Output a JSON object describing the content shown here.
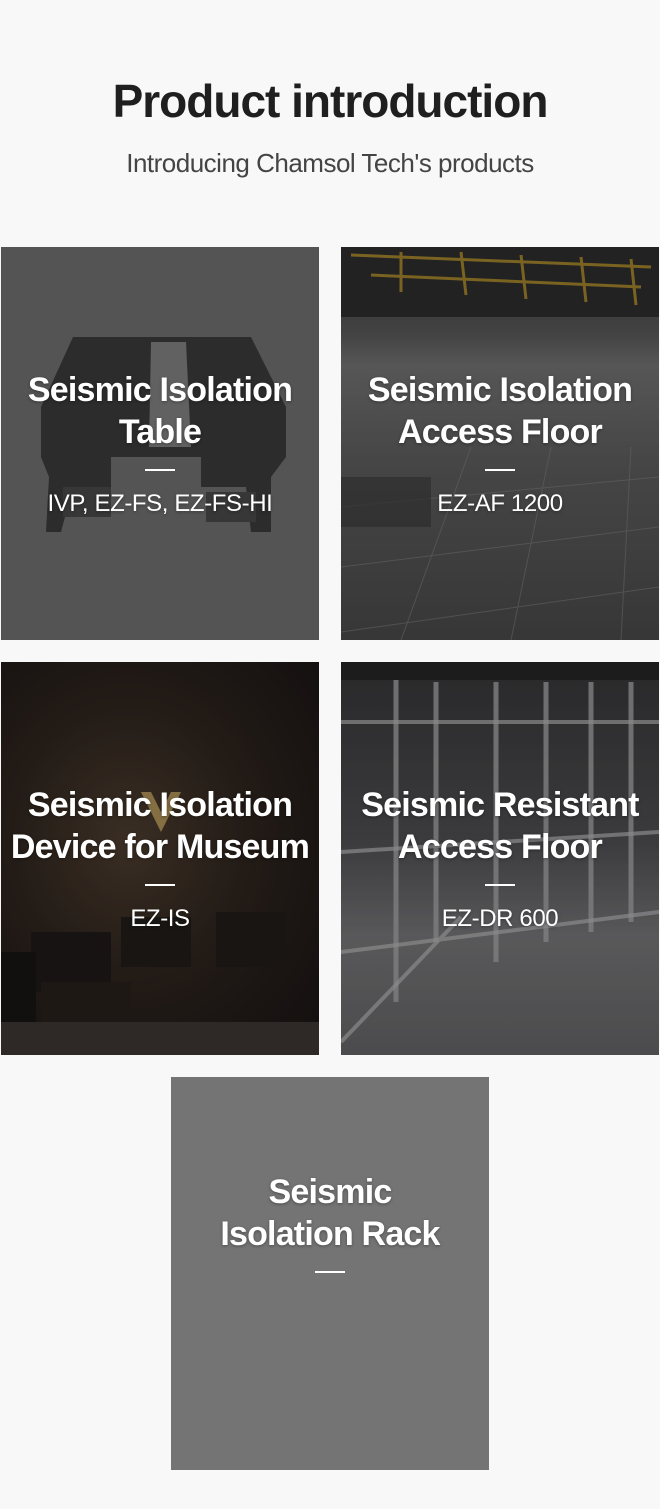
{
  "header": {
    "title": "Product introduction",
    "subtitle": "Introducing Chamsol Tech's products"
  },
  "products": [
    {
      "title_line1": "Seismic Isolation",
      "title_line2": "Table",
      "code": "IVP, EZ-FS, EZ-FS-HI"
    },
    {
      "title_line1": "Seismic Isolation",
      "title_line2": "Access Floor",
      "code": "EZ-AF 1200"
    },
    {
      "title_line1": "Seismic Isolation",
      "title_line2": "Device for Museum",
      "code": "EZ-IS"
    },
    {
      "title_line1": "Seismic Resistant",
      "title_line2": "Access Floor",
      "code": "EZ-DR 600"
    },
    {
      "title_line1": "Seismic",
      "title_line2": "Isolation Rack",
      "code": ""
    }
  ]
}
